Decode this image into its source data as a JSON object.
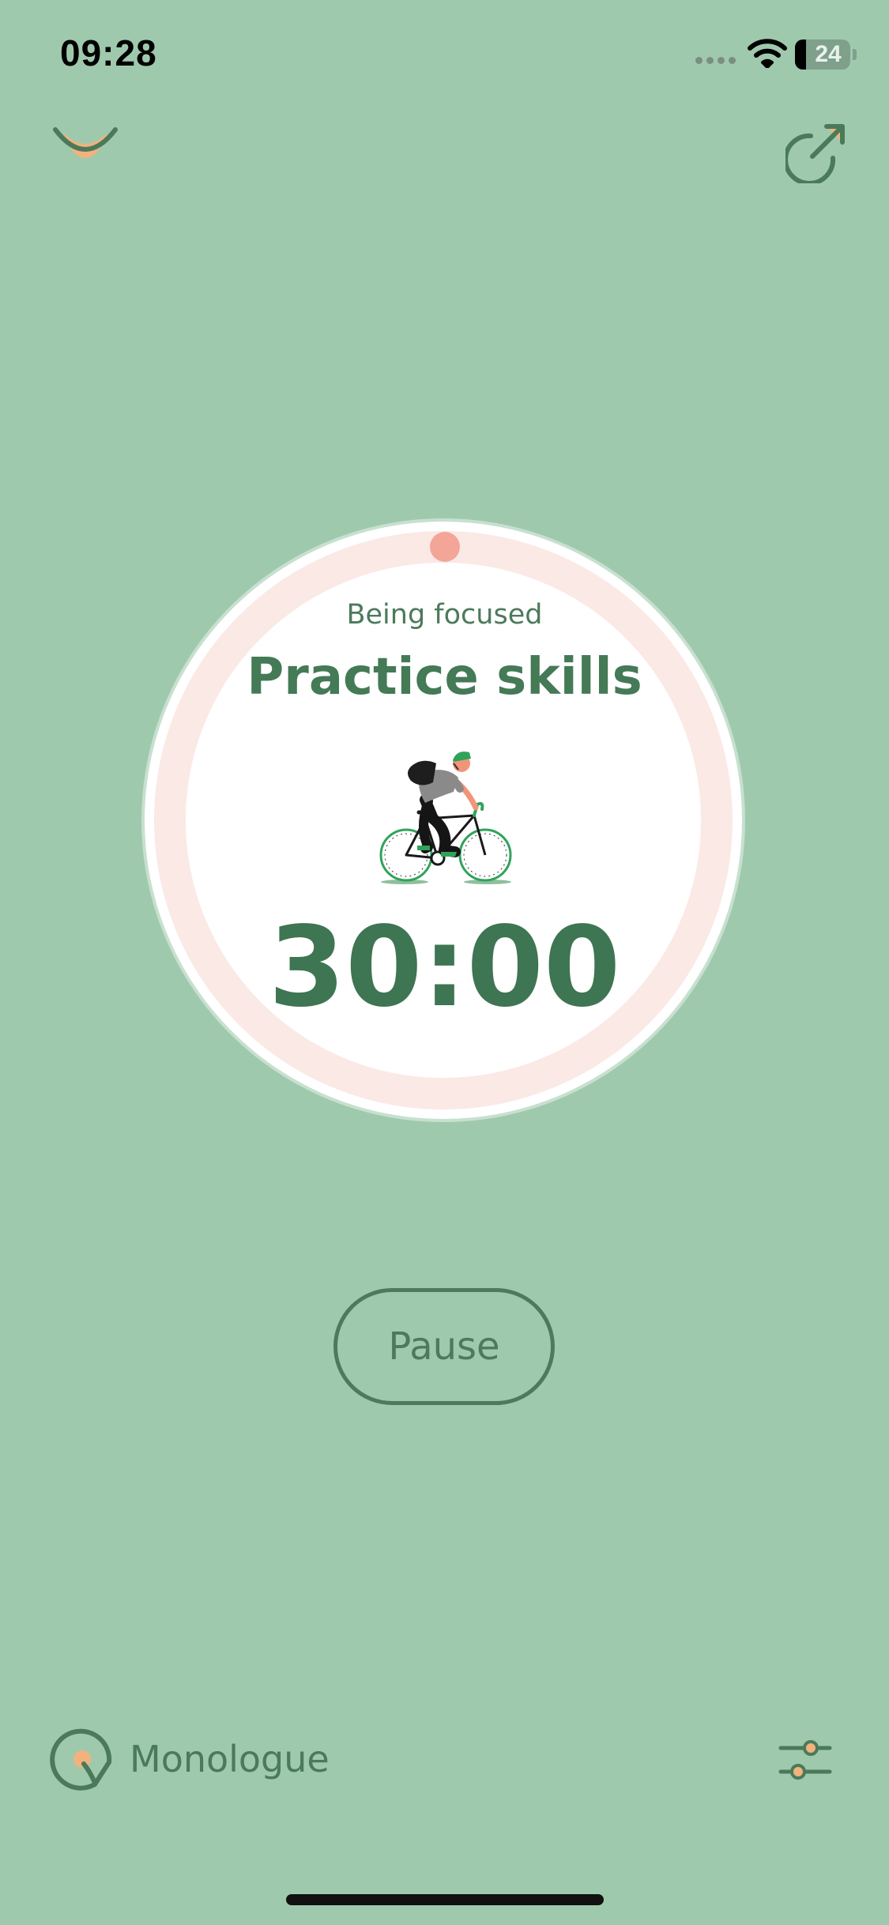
{
  "status_bar": {
    "time": "09:28",
    "battery_level": "24",
    "icons": [
      "signal-icon",
      "wifi-icon",
      "battery-icon"
    ]
  },
  "top_bar": {
    "left_icon": "chevron-down-icon",
    "right_icon": "share-icon"
  },
  "timer": {
    "status": "Being focused",
    "task": "Practice skills",
    "time_remaining": "30:00",
    "progress": 0.0,
    "illustration": "cyclist-illustration"
  },
  "controls": {
    "pause_label": "Pause"
  },
  "bottom_bar": {
    "mode_icon": "monologue-icon",
    "mode_label": "Monologue",
    "settings_icon": "sliders-icon"
  },
  "colors": {
    "background": "#9fc9ad",
    "accent_green": "#447a56",
    "ring": "#fbe9e6",
    "knob": "#f3a597",
    "highlight": "#f2b27d"
  }
}
